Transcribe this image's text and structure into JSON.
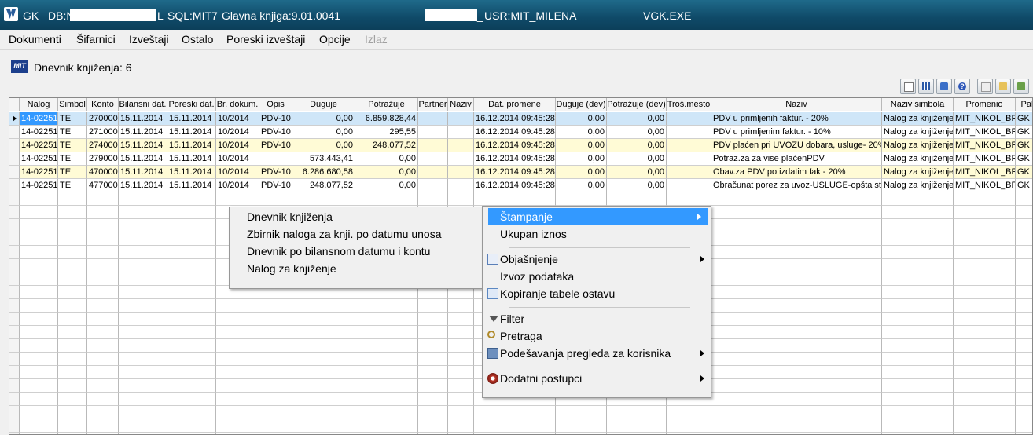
{
  "titlebar": {
    "app": "GK",
    "db": "DB:N",
    "db_tail": "L",
    "sql": "SQL:MIT7",
    "module": "Glavna knjiga:9.01.0041",
    "sep": "_",
    "user": "USR:MIT_MILENA",
    "exe": "VGK.EXE"
  },
  "menubar": [
    "Dokumenti",
    "Šifarnici",
    "Izveštaji",
    "Ostalo",
    "Poreski izveštaji",
    "Opcije",
    "Izlaz"
  ],
  "panel": {
    "logo": "MIT",
    "title": "Dnevnik knjiženja: 6"
  },
  "grid": {
    "columns": [
      "Nalog",
      "Simbol",
      "Konto",
      "Bilansni dat.",
      "Poreski dat.",
      "Br. dokum.",
      "Opis",
      "Duguje",
      "Potražuje",
      "Partner",
      "Naziv",
      "Dat. promene",
      "Duguje (dev)",
      "Potražuje (dev)",
      "Troš.mesto",
      "Naziv",
      "Naziv simbola",
      "Promenio",
      "Pal"
    ],
    "rows": [
      [
        "14-02251",
        "TE",
        "270000",
        "15.11.2014",
        "15.11.2014",
        "10/2014",
        "PDV-10",
        "0,00",
        "6.859.828,44",
        "",
        "",
        "16.12.2014 09:45:28",
        "0,00",
        "0,00",
        "",
        "PDV u primljenih faktur. - 20%",
        "Nalog za knjiženje",
        "MIT_NIKOL_BR",
        "GK"
      ],
      [
        "14-02251",
        "TE",
        "271000",
        "15.11.2014",
        "15.11.2014",
        "10/2014",
        "PDV-10",
        "0,00",
        "295,55",
        "",
        "",
        "16.12.2014 09:45:28",
        "0,00",
        "0,00",
        "",
        "PDV u primljenim faktur. - 10%",
        "Nalog za knjiženje",
        "MIT_NIKOL_BR",
        "GK"
      ],
      [
        "14-02251",
        "TE",
        "274000",
        "15.11.2014",
        "15.11.2014",
        "10/2014",
        "PDV-10",
        "0,00",
        "248.077,52",
        "",
        "",
        "16.12.2014 09:45:28",
        "0,00",
        "0,00",
        "",
        "PDV plaćen pri UVOZU dobara, usluge- 20%",
        "Nalog za knjiženje",
        "MIT_NIKOL_BR",
        "GK"
      ],
      [
        "14-02251",
        "TE",
        "279000",
        "15.11.2014",
        "15.11.2014",
        "10/2014",
        "",
        "573.443,41",
        "0,00",
        "",
        "",
        "16.12.2014 09:45:28",
        "0,00",
        "0,00",
        "",
        "Potraz.za  za vise plaćenPDV",
        "Nalog za knjiženje",
        "MIT_NIKOL_BR",
        "GK"
      ],
      [
        "14-02251",
        "TE",
        "470000",
        "15.11.2014",
        "15.11.2014",
        "10/2014",
        "PDV-10",
        "6.286.680,58",
        "0,00",
        "",
        "",
        "16.12.2014 09:45:28",
        "0,00",
        "0,00",
        "",
        "Obav.za PDV po izdatim fak - 20%",
        "Nalog za knjiženje",
        "MIT_NIKOL_BR",
        "GK"
      ],
      [
        "14-02251",
        "TE",
        "477000",
        "15.11.2014",
        "15.11.2014",
        "10/2014",
        "PDV-10",
        "248.077,52",
        "0,00",
        "",
        "",
        "16.12.2014 09:45:28",
        "0,00",
        "0,00",
        "",
        "Obračunat porez za uvoz-USLUGE-opšta sto",
        "Nalog za knjiženje",
        "MIT_NIKOL_BR",
        "GK"
      ]
    ]
  },
  "submenu": [
    "Dnevnik knjiženja",
    "Zbirnik naloga za knji. po datumu unosa",
    "Dnevnik po bilansnom datumu i kontu",
    "Nalog za knjiženje"
  ],
  "context_menu": {
    "print": "Štampanje",
    "total": "Ukupan iznos",
    "explain": "Objašnjenje",
    "export": "Izvoz podataka",
    "copy_table": "Kopiranje tabele ostavu",
    "filter": "Filter",
    "search": "Pretraga",
    "view_settings": "Podešavanja pregleda za korisnika",
    "extra": "Dodatni postupci"
  }
}
